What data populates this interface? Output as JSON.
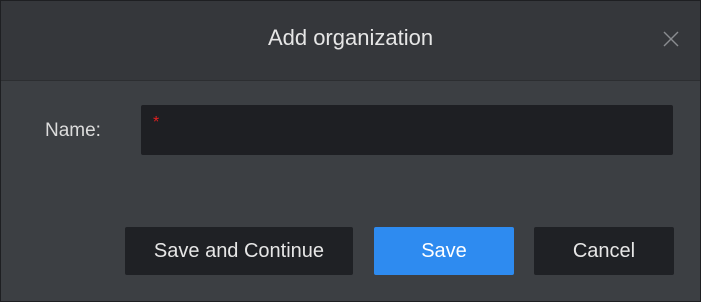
{
  "dialog": {
    "title": "Add organization",
    "close_icon": "close-icon"
  },
  "form": {
    "name_label": "Name:",
    "name_value": "",
    "name_placeholder": "",
    "required_marker": "*"
  },
  "buttons": {
    "save_and_continue": "Save and Continue",
    "save": "Save",
    "cancel": "Cancel"
  },
  "colors": {
    "primary_button": "#2e8bf0",
    "required_marker": "#e02020",
    "background": "#3c3f43"
  }
}
